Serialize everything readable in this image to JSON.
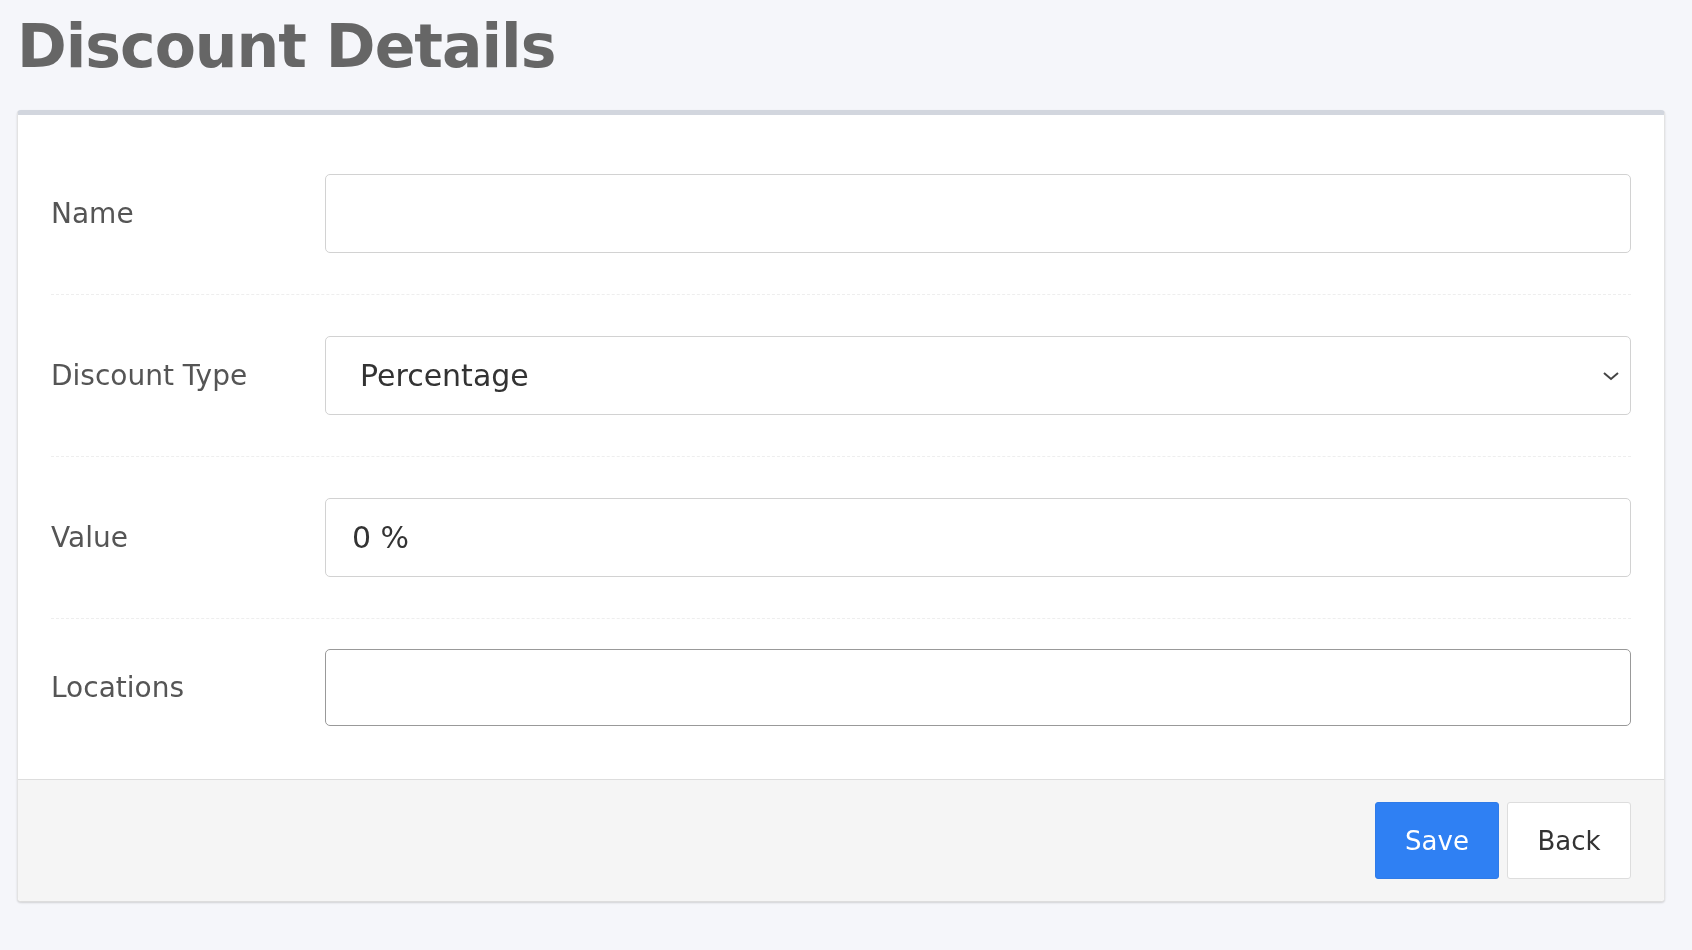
{
  "page_title": "Discount Details",
  "fields": [
    {
      "label": "Name",
      "kind": "text"
    },
    {
      "label": "Discount Type",
      "kind": "select",
      "value": "Percentage"
    },
    {
      "label": "Value",
      "kind": "text",
      "value": "0 %"
    },
    {
      "label": "Locations",
      "kind": "multiselect"
    }
  ],
  "buttons": [
    {
      "label": "Save",
      "kind": "primary"
    },
    {
      "label": "Back",
      "kind": "default"
    }
  ]
}
